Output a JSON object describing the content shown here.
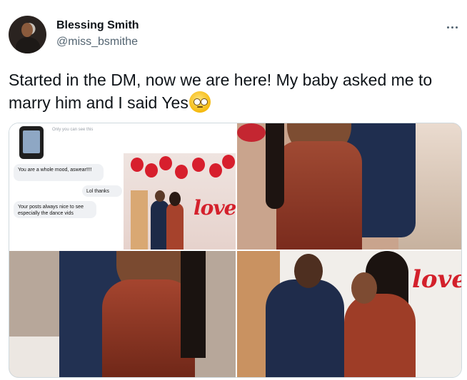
{
  "author": {
    "name": "Blessing Smith",
    "handle": "@miss_bsmithe"
  },
  "tweet": {
    "text": "Started in the DM, now we are here! My baby asked me to marry him and I said Yes",
    "emoji_icon": "face-with-pleading-eyes-icon"
  },
  "media": {
    "dm_messages": [
      "You are a whole mood, aswear!!!!",
      "Lol thanks",
      "Your posts always nice to see especially the dance vids"
    ],
    "dm_seen": "Only you can see this",
    "love_sign": "love",
    "love_sign_4": "love"
  },
  "colors": {
    "text": "#0f1419",
    "secondary": "#536471",
    "border": "#cfd9de",
    "accent_red": "#d4212c"
  }
}
